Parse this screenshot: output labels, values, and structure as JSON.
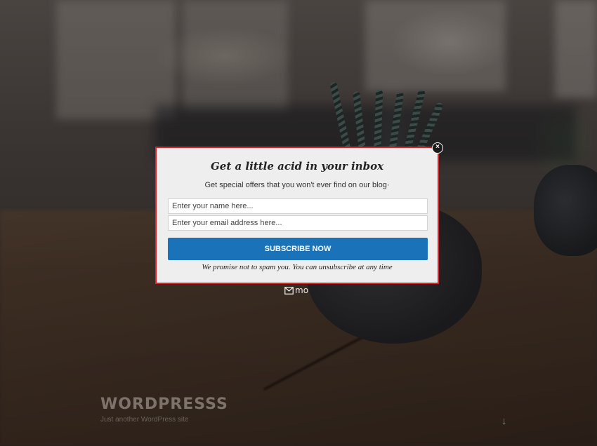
{
  "popup": {
    "title": "Get a little acid in your inbox",
    "subtitle": "Get special offers that you won't ever find on our blog·",
    "name_placeholder": "Enter your name here...",
    "email_placeholder": "Enter your email address here...",
    "subscribe_label": "SUBSCRIBE NOW",
    "no_spam_text": "We promise not to spam you. You can unsubscribe at any time",
    "close_icon": "close-icon",
    "close_glyph": "×",
    "brand_text": "mo",
    "border_color": "#d9262d",
    "button_color": "#1a72b8"
  },
  "site": {
    "title": "WORDPRESSS",
    "tagline": "Just another WordPress site",
    "scroll_glyph": "↓"
  }
}
